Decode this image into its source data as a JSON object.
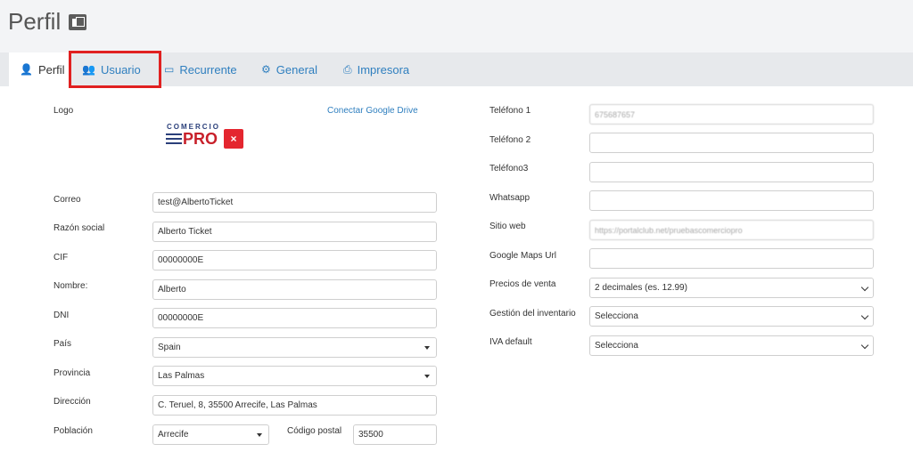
{
  "header": {
    "title": "Perfil"
  },
  "tabs": [
    {
      "label": "Perfil"
    },
    {
      "label": "Usuario"
    },
    {
      "label": "Recurrente"
    },
    {
      "label": "General"
    },
    {
      "label": "Impresora"
    }
  ],
  "left": {
    "logo_label": "Logo",
    "connect_link": "Conectar Google Drive",
    "logo_text_small": "COMERCIO",
    "logo_text_big": "PRO",
    "logo_remove": "×",
    "correo": {
      "label": "Correo",
      "value": "test@AlbertoTicket"
    },
    "razon": {
      "label": "Razón social",
      "value": "Alberto Ticket"
    },
    "cif": {
      "label": "CIF",
      "value": "00000000E"
    },
    "nombre": {
      "label": "Nombre:",
      "value": "Alberto"
    },
    "dni": {
      "label": "DNI",
      "value": "00000000E"
    },
    "pais": {
      "label": "País",
      "value": "Spain"
    },
    "provincia": {
      "label": "Provincia",
      "value": "Las Palmas"
    },
    "direccion": {
      "label": "Dirección",
      "value": "C. Teruel, 8, 35500 Arrecife, Las Palmas"
    },
    "poblacion": {
      "label": "Población",
      "value": "Arrecife"
    },
    "cp": {
      "label": "Código postal",
      "value": "35500"
    }
  },
  "right": {
    "tel1": {
      "label": "Teléfono 1",
      "value": "675687657"
    },
    "tel2": {
      "label": "Teléfono 2",
      "value": ""
    },
    "tel3": {
      "label": "Teléfono3",
      "value": ""
    },
    "whatsapp": {
      "label": "Whatsapp",
      "value": ""
    },
    "web": {
      "label": "Sitio web",
      "value": "https://portalclub.net/pruebascomerciopro"
    },
    "maps": {
      "label": "Google Maps Url",
      "value": ""
    },
    "precios": {
      "label": "Precios de venta",
      "value": "2 decimales (es. 12.99)"
    },
    "inventario": {
      "label": "Gestión del inventario",
      "value": "Selecciona"
    },
    "iva": {
      "label": "IVA default",
      "value": "Selecciona"
    }
  },
  "colors": {
    "accent": "#2f7fbf",
    "highlight": "#e02020",
    "brand_red": "#c8202a",
    "brand_blue": "#2a3f7a"
  }
}
